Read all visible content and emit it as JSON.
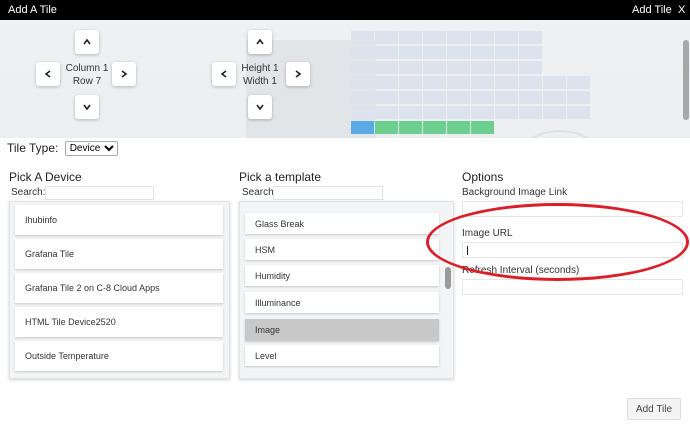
{
  "window": {
    "title": "Add A Tile",
    "add_tile_label": "Add Tile",
    "close_label": "X"
  },
  "position_controls": {
    "column_label": "Column 1",
    "row_label": "Row 7"
  },
  "size_controls": {
    "height_label": "Height 1",
    "width_label": "Width 1"
  },
  "layout_grid": {
    "colors": {
      "empty": "#dde3ec",
      "selected": "#5aaae3",
      "occupied": "#6ccf8f"
    }
  },
  "tile_type": {
    "label": "Tile Type:",
    "selected": "Device"
  },
  "device_picker": {
    "title": "Pick A Device",
    "search_label": "Search:",
    "search_value": "",
    "items": [
      "Ihubinfo",
      "Grafana Tile",
      "Grafana Tile 2 on C-8 Cloud Apps",
      "HTML Tile Device2520",
      "Outside Temperature"
    ]
  },
  "template_picker": {
    "title": "Pick a template",
    "search_label": "Search:",
    "search_value": "",
    "items": [
      "Glass Break",
      "HSM",
      "Humidity",
      "Illuminance",
      "Image",
      "Level"
    ],
    "selected": "Image"
  },
  "options": {
    "title": "Options",
    "background_image_label": "Background Image Link",
    "background_image_value": "",
    "image_url_label": "Image URL",
    "image_url_value": "",
    "refresh_interval_label": "Refresh Interval (seconds)",
    "refresh_interval_value": ""
  },
  "footer": {
    "add_tile_button": "Add Tile"
  },
  "annotation": {
    "color": "#d9202a"
  }
}
